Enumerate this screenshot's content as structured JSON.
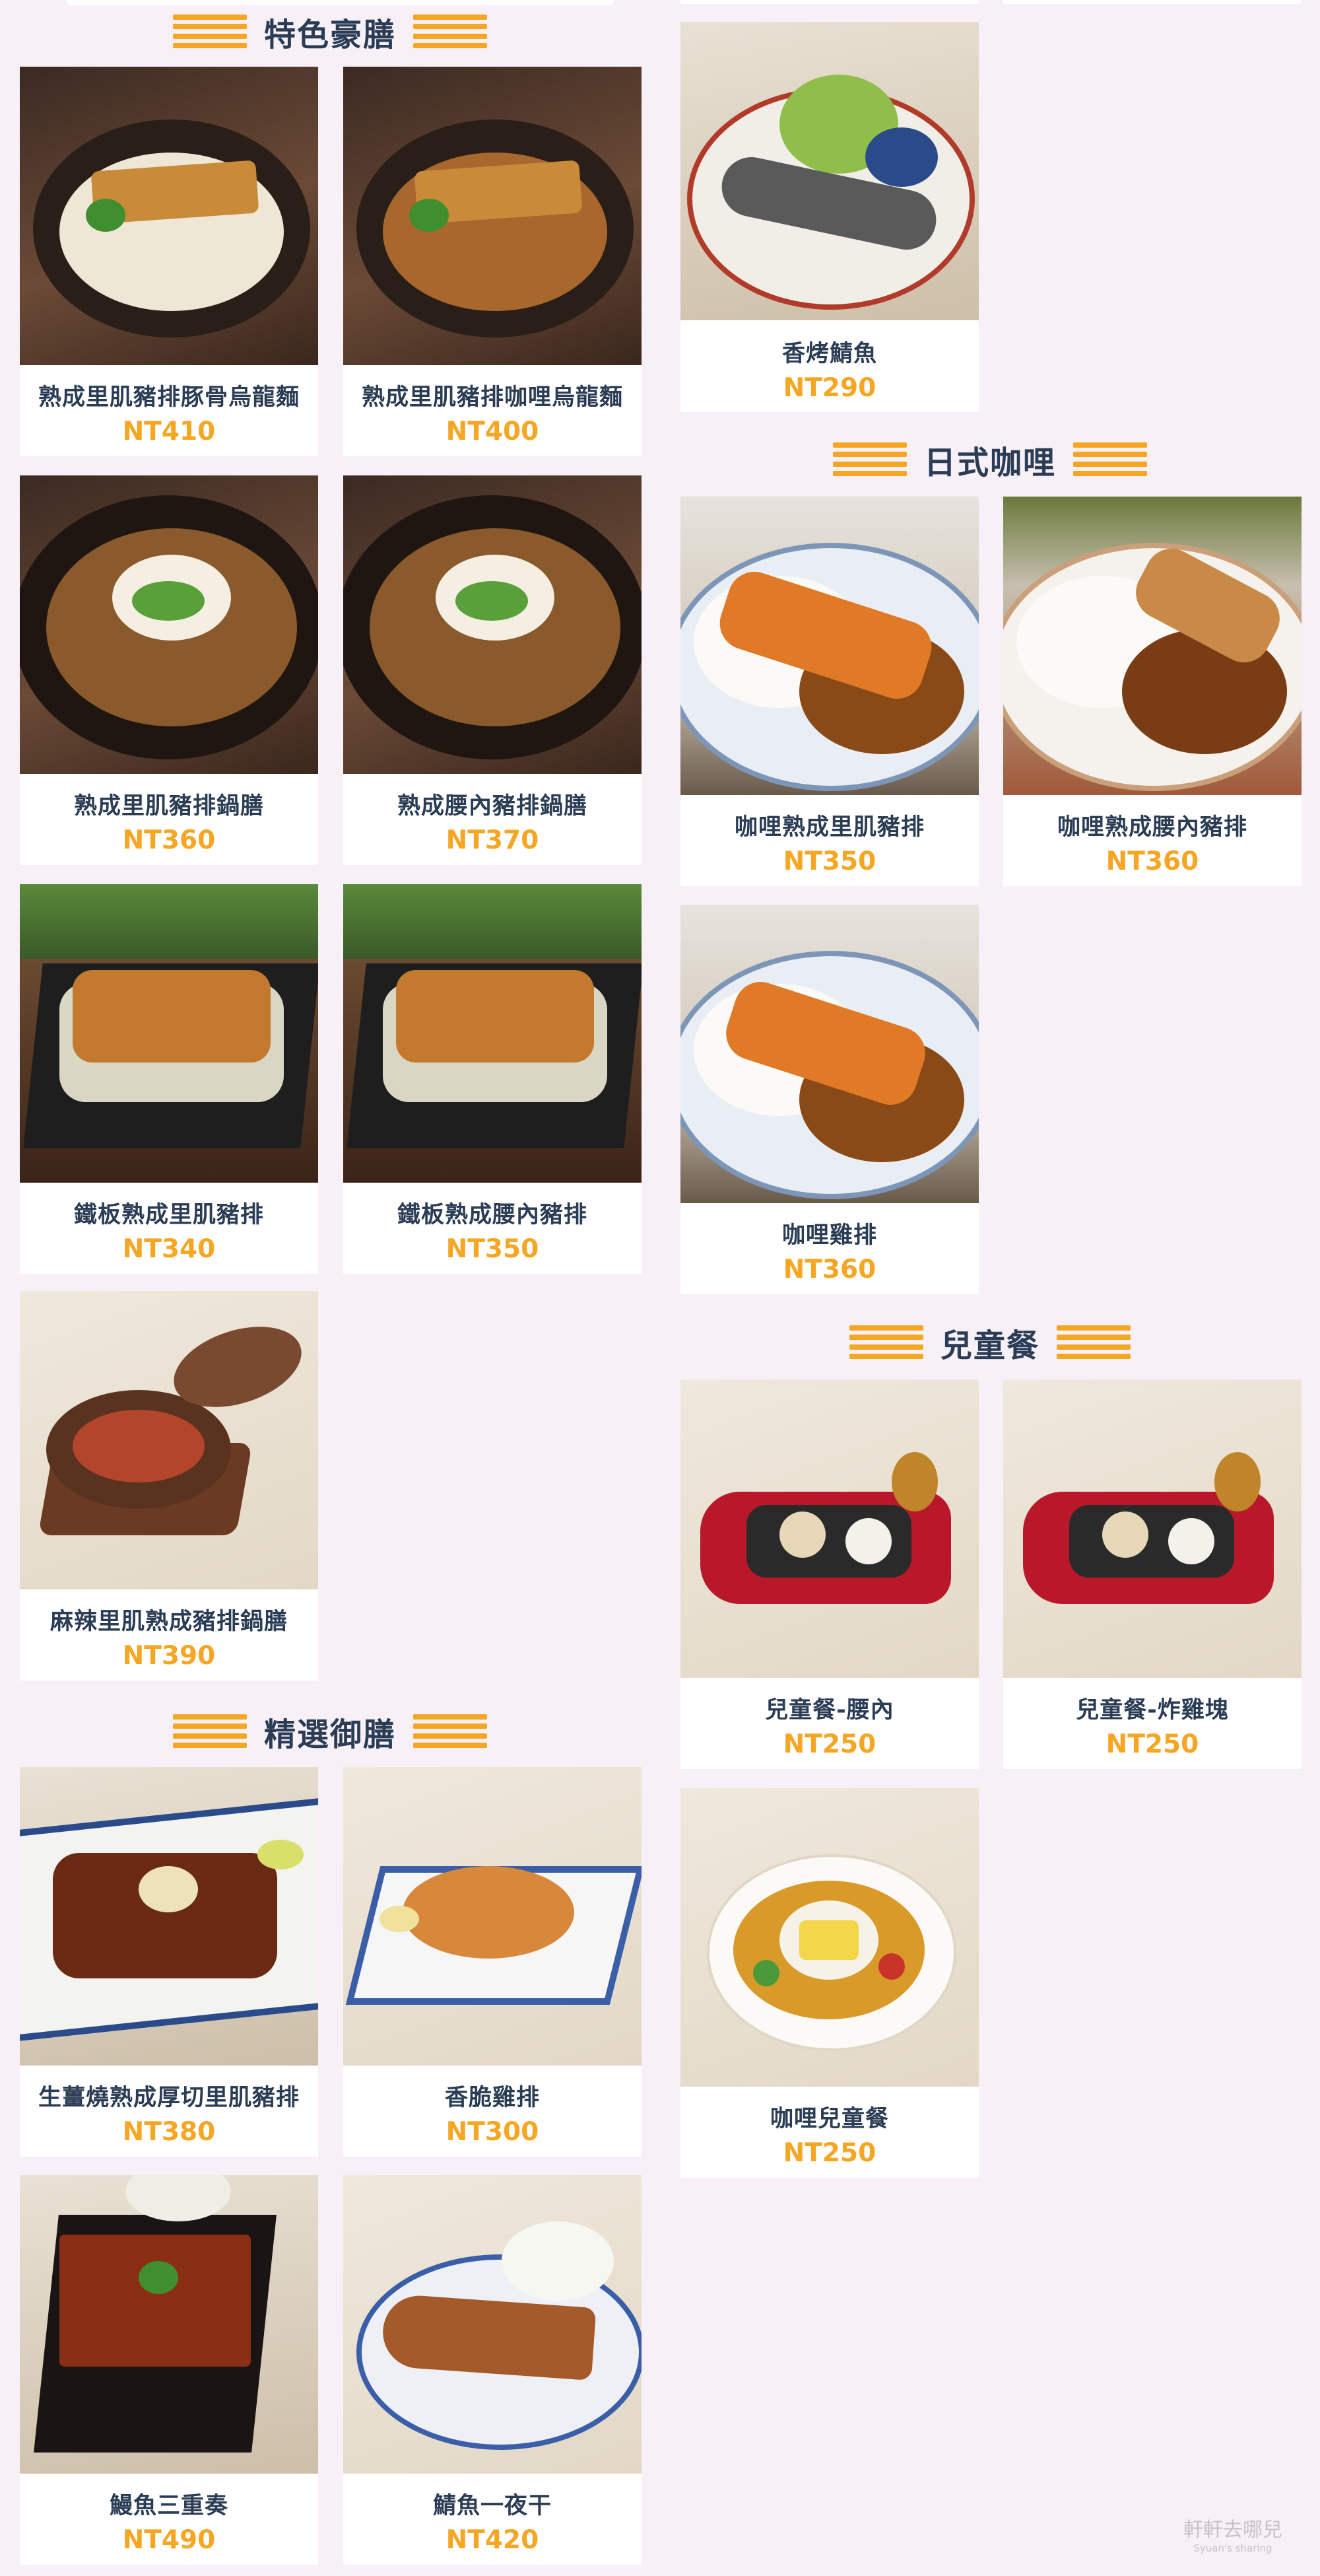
{
  "sections": {
    "special": {
      "title": "特色豪膳"
    },
    "selected": {
      "title": "精選御膳"
    },
    "curry": {
      "title": "日式咖哩"
    },
    "kids": {
      "title": "兒童餐"
    }
  },
  "items": {
    "s1": {
      "name": "熟成里肌豬排豚骨烏龍麵",
      "price": "NT410",
      "icon": "tonkotsu-udon-photo"
    },
    "s2": {
      "name": "熟成里肌豬排咖哩烏龍麵",
      "price": "NT400",
      "icon": "curry-udon-photo"
    },
    "s3": {
      "name": "熟成里肌豬排鍋膳",
      "price": "NT360",
      "icon": "pork-hotpot-photo"
    },
    "s4": {
      "name": "熟成腰內豬排鍋膳",
      "price": "NT370",
      "icon": "fillet-hotpot-photo"
    },
    "s5": {
      "name": "鐵板熟成里肌豬排",
      "price": "NT340",
      "icon": "teppan-loin-photo"
    },
    "s6": {
      "name": "鐵板熟成腰內豬排",
      "price": "NT350",
      "icon": "teppan-fillet-photo"
    },
    "s7": {
      "name": "麻辣里肌熟成豬排鍋膳",
      "price": "NT390",
      "icon": "spicy-hotpot-photo"
    },
    "p1": {
      "name": "生薑燒熟成厚切里肌豬排",
      "price": "NT380",
      "icon": "ginger-pork-photo"
    },
    "p2": {
      "name": "香脆雞排",
      "price": "NT300",
      "icon": "crispy-chicken-photo"
    },
    "p3": {
      "name": "鰻魚三重奏",
      "price": "NT490",
      "icon": "eel-box-photo"
    },
    "p4": {
      "name": "鯖魚一夜干",
      "price": "NT420",
      "icon": "dried-fish-photo"
    },
    "r0": {
      "name": "香烤鯖魚",
      "price": "NT290",
      "icon": "grilled-mackerel-photo"
    },
    "c1": {
      "name": "咖哩熟成里肌豬排",
      "price": "NT350",
      "icon": "curry-loin-photo"
    },
    "c2": {
      "name": "咖哩熟成腰內豬排",
      "price": "NT360",
      "icon": "curry-fillet-photo"
    },
    "c3": {
      "name": "咖哩雞排",
      "price": "NT360",
      "icon": "curry-chicken-photo"
    },
    "k1": {
      "name": "兒童餐-腰內",
      "price": "NT250",
      "icon": "kids-car-plate-photo"
    },
    "k2": {
      "name": "兒童餐-炸雞塊",
      "price": "NT250",
      "icon": "kids-car-plate-photo"
    },
    "k3": {
      "name": "咖哩兒童餐",
      "price": "NT250",
      "icon": "kids-curry-photo"
    }
  },
  "watermark": {
    "text": "軒軒去哪兒",
    "sub": "Syuan's sharing"
  },
  "colors": {
    "background": "#f7f0f6",
    "title": "#2b3c55",
    "price": "#f5a623",
    "accent_bars": "#f5a623"
  }
}
